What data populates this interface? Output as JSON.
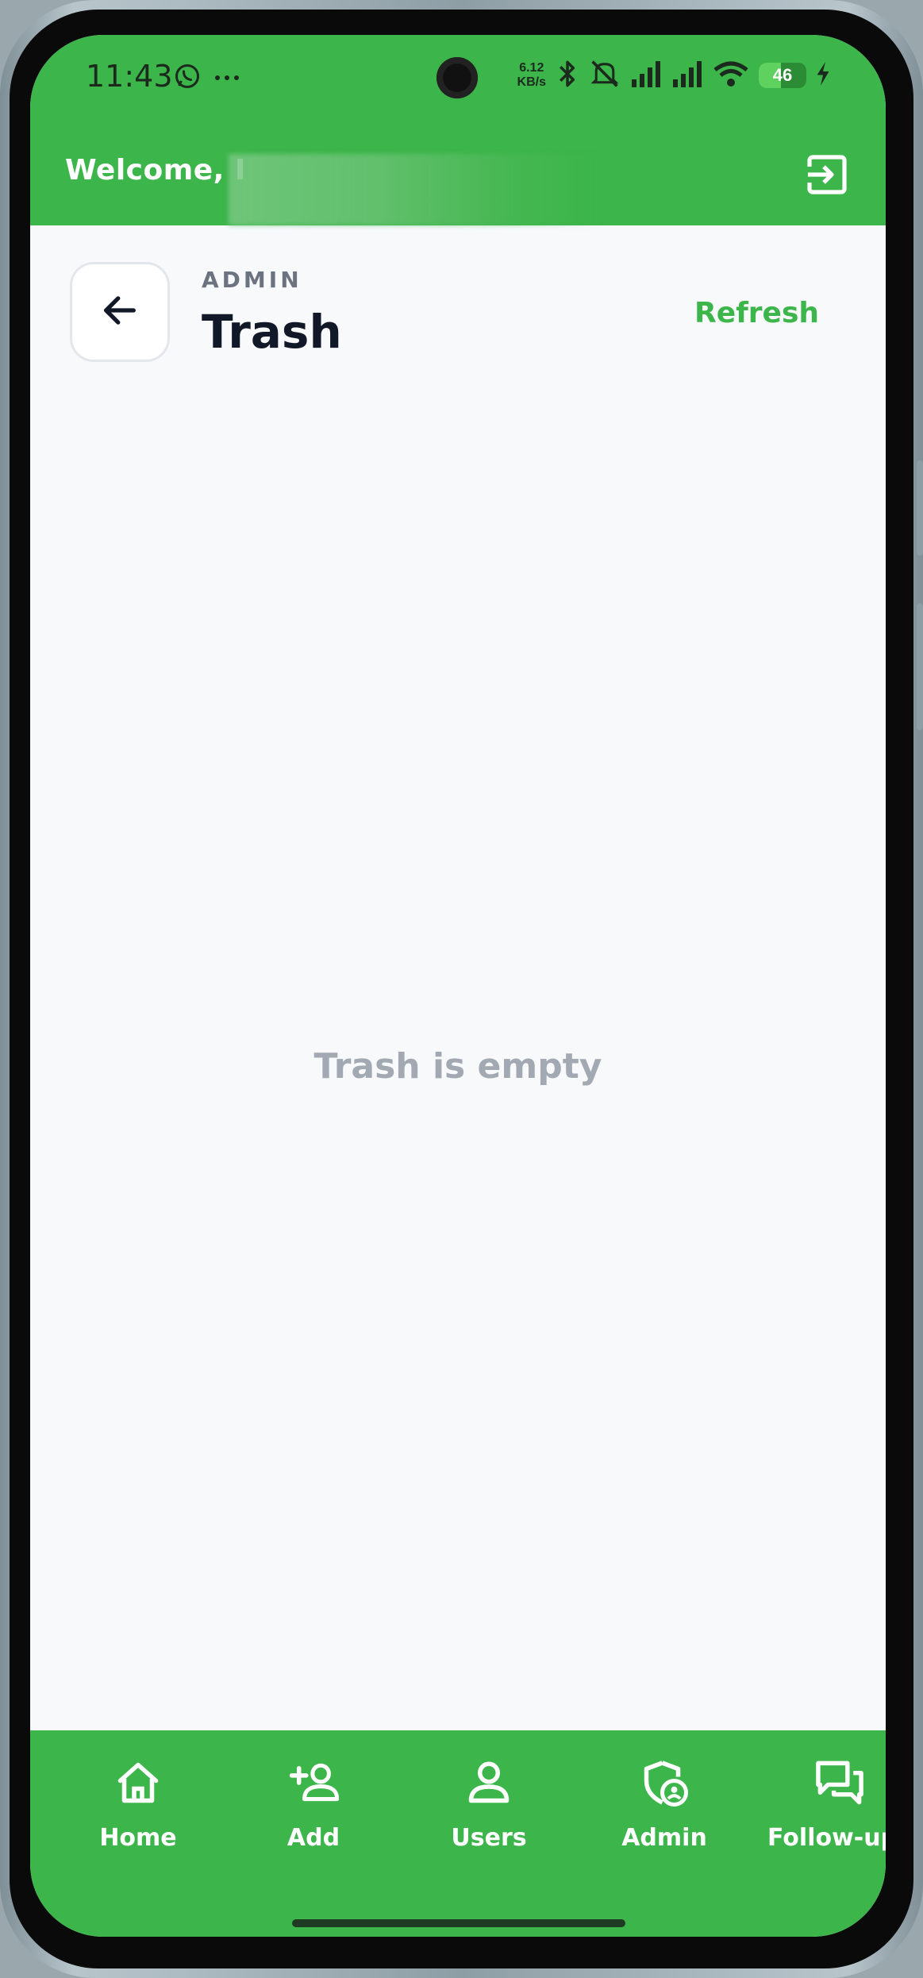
{
  "status_bar": {
    "time": "11:43",
    "net_speed_value": "6.12",
    "net_speed_unit": "KB/s",
    "battery": "46",
    "icons": [
      "whatsapp-icon",
      "more-dots-icon",
      "bluetooth-icon",
      "mute-icon",
      "signal-icon",
      "signal-icon",
      "wifi-icon",
      "charging-icon"
    ]
  },
  "topbar": {
    "welcome": "Welcome, I",
    "logout_icon": "logout-icon"
  },
  "header": {
    "overline": "ADMIN",
    "title": "Trash",
    "refresh_label": "Refresh",
    "back_icon": "arrow-left-icon"
  },
  "main": {
    "empty_message": "Trash is empty"
  },
  "bottom_nav": {
    "items": [
      {
        "label": "Home",
        "icon": "home-icon"
      },
      {
        "label": "Add",
        "icon": "add-user-icon"
      },
      {
        "label": "Users",
        "icon": "user-icon"
      },
      {
        "label": "Admin",
        "icon": "admin-shield-icon"
      },
      {
        "label": "Follow-ups",
        "icon": "chat-bubbles-icon"
      }
    ]
  },
  "colors": {
    "brand_green": "#3cb54a",
    "background": "#f7f9fb",
    "title_text": "#111827",
    "muted_text": "#a3a9b3"
  }
}
